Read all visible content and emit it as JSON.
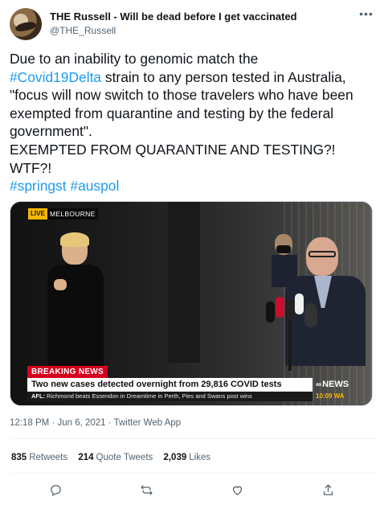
{
  "author": {
    "display_name": "THE Russell - Will be dead before I get vaccinated",
    "handle": "@THE_Russell",
    "more_icon": "more-horizontal-icon"
  },
  "tweet": {
    "lines": [
      {
        "text": "Due to an inability to genomic match the"
      },
      {
        "tag": "#Covid19Delta",
        "text": " strain to any person tested in Australia,"
      },
      {
        "text": "\"focus will now switch to those travelers who have been"
      },
      {
        "text": "exempted from quarantine and testing by the federal"
      },
      {
        "text": "government\"."
      },
      {
        "text": "EXEMPTED FROM QUARANTINE AND TESTING?!"
      },
      {
        "text": "WTF?!"
      }
    ],
    "hashtags": [
      "#springst",
      "#auspol"
    ]
  },
  "media": {
    "live_label": "LIVE",
    "location": "MELBOURNE",
    "breaking_label": "BREAKING NEWS",
    "headline": "Two new cases detected overnight from 29,816 COVID tests",
    "ticker_prefix": "AFL:",
    "ticker_text": " Richmond beats Essendon in Dreamtime in Perth, Pies and Swans post wins",
    "brand": "NEWS",
    "time": "10:09 WA"
  },
  "meta": {
    "time": "12:18 PM",
    "date": "Jun 6, 2021",
    "source": "Twitter Web App"
  },
  "stats": {
    "retweets_count": "835",
    "retweets_label": "Retweets",
    "quotes_count": "214",
    "quotes_label": "Quote Tweets",
    "likes_count": "2,039",
    "likes_label": "Likes"
  },
  "actions": [
    "reply-icon",
    "retweet-icon",
    "like-icon",
    "share-icon"
  ],
  "colors": {
    "link": "#1d9bf0",
    "text": "#0f1419",
    "muted": "#536471",
    "breaking_red": "#d6001c",
    "live_yellow": "#f7b500"
  }
}
